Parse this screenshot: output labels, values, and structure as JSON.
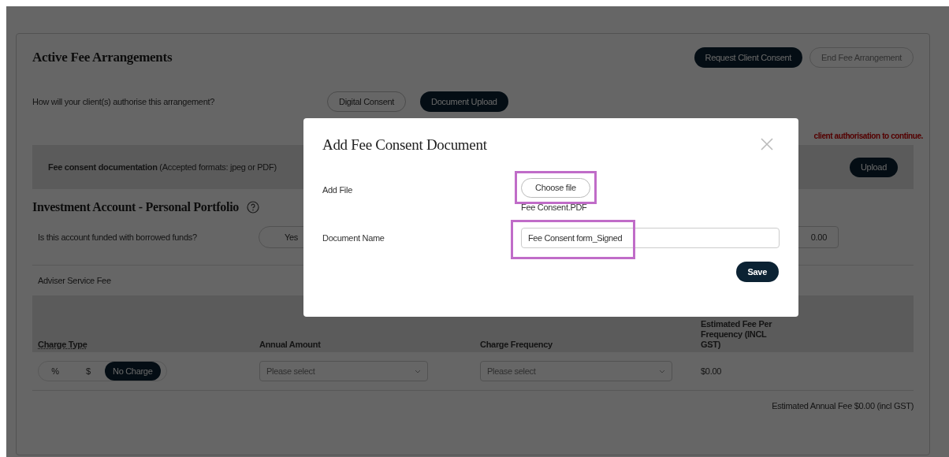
{
  "page": {
    "title": "Active Fee Arrangements",
    "actions": [
      {
        "label": "Request Client Consent",
        "disabled": false
      },
      {
        "label": "End Fee Arrangement",
        "disabled": true
      }
    ],
    "authorisation": {
      "question": "How will your client(s) authorise this arrangement?",
      "options": [
        {
          "label": "Digital Consent",
          "selected": false
        },
        {
          "label": "Document Upload",
          "selected": true
        }
      ],
      "warning": "client authorisation to continue."
    },
    "documentation": {
      "text": "**Fee consent documentation** (Accepted formats: jpeg or PDF)",
      "button": "Upload"
    },
    "account": {
      "title": "Investment Account - Personal Portfolio",
      "borrowed_question": "Is this account funded with borrowed funds?",
      "borrowed_options": [
        {
          "label": "Yes",
          "selected": false
        }
      ],
      "amount": "0.00"
    },
    "fee": {
      "title": "Adviser Service Fee",
      "columns": [
        "Charge Type",
        "Annual Amount",
        "Charge Frequency",
        "Estimated Fee Per Frequency (INCL GST)"
      ],
      "charge_types": [
        {
          "label": "%",
          "selected": false
        },
        {
          "label": "$",
          "selected": false
        },
        {
          "label": "No Charge",
          "selected": true
        }
      ],
      "annual_amount": {
        "placeholder": "Please select"
      },
      "frequency": {
        "placeholder": "Please select"
      },
      "estimated": "$0.00",
      "total": "Estimated Annual Fee $0.00 (incl GST)"
    }
  },
  "modal": {
    "title": "Add Fee Consent Document",
    "fields": [
      {
        "kind": "file",
        "label": "Add File",
        "button": "Choose file",
        "file_name": "Fee Consent.PDF",
        "highlighted": true
      },
      {
        "kind": "text",
        "label": "Document Name",
        "value": "Fee Consent form_Signed",
        "highlighted": true
      }
    ],
    "save": "Save"
  }
}
